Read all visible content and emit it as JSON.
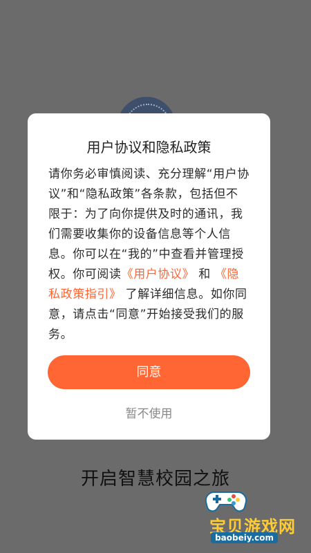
{
  "dialog": {
    "title": "用户协议和隐私政策",
    "body_intro": "请你务必审慎阅读、充分理解“用户协议”和“隐私政策”各条款，包括但不限于：为了向你提供及时的通讯，我们需要收集你的设备信息等个人信息。你可以在“我的”中查看并管理授权。你可阅读",
    "link_user_agreement": "《用户协议》",
    "connector": "和",
    "link_privacy_guide": "《隐私政策指引》",
    "body_outro": "了解详细信息。如你同意，请点击“同意”开始接受我们的服务。",
    "agree_label": "同意",
    "decline_label": "暂不使用"
  },
  "background": {
    "slogan": "开启智慧校园之旅"
  },
  "watermark": {
    "name": "宝贝游戏网",
    "url": "baobeiy.com"
  },
  "colors": {
    "accent": "#ff6633",
    "overlay": "#6b6b6b"
  }
}
